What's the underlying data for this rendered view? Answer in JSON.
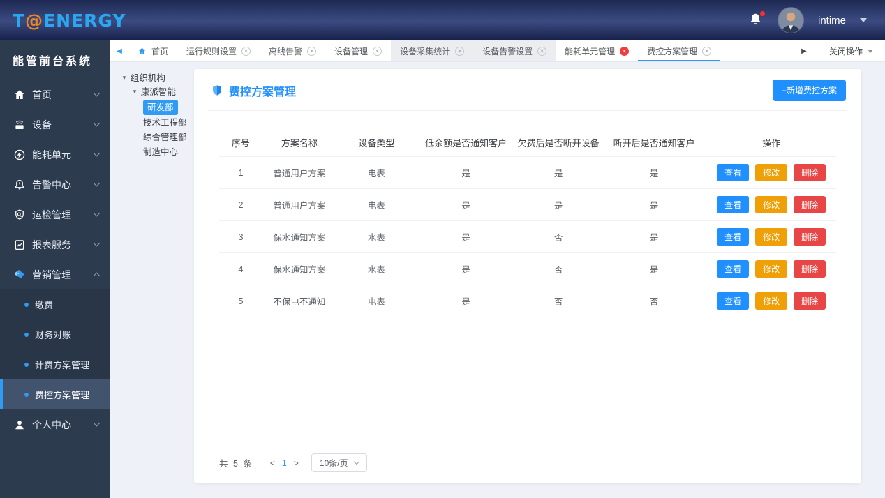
{
  "brand": {
    "logo_t": "T",
    "logo_at": "@",
    "logo_energy": "ENERGY"
  },
  "topbar": {
    "username": "intime"
  },
  "colors": {
    "accent": "#2f9bf4",
    "edit": "#efa007",
    "delete": "#e84646",
    "tab_close_alert": "#f23c3c"
  },
  "sidebar": {
    "app_title": "能管前台系统",
    "items": [
      {
        "key": "home",
        "label": "首页",
        "icon": "home-icon"
      },
      {
        "key": "device",
        "label": "设备",
        "icon": "device-icon"
      },
      {
        "key": "energy-unit",
        "label": "能耗单元",
        "icon": "energy-icon"
      },
      {
        "key": "alarm-center",
        "label": "告警中心",
        "icon": "alarm-icon"
      },
      {
        "key": "inspection",
        "label": "运检管理",
        "icon": "inspection-icon"
      },
      {
        "key": "reports",
        "label": "报表服务",
        "icon": "report-icon"
      },
      {
        "key": "marketing",
        "label": "营销管理",
        "icon": "tags-icon",
        "expanded": true,
        "children": [
          {
            "key": "payment",
            "label": "缴费"
          },
          {
            "key": "finance-reconcile",
            "label": "财务对账"
          },
          {
            "key": "billing-plan",
            "label": "计费方案管理"
          },
          {
            "key": "fee-control-plan",
            "label": "费控方案管理",
            "active": true
          }
        ]
      },
      {
        "key": "personal-center",
        "label": "个人中心",
        "icon": "user-icon"
      }
    ]
  },
  "tabbar": {
    "tabs": [
      {
        "key": "home",
        "label": "首页",
        "home": true
      },
      {
        "key": "run-rules",
        "label": "运行规则设置",
        "closable": true
      },
      {
        "key": "offline-alarm",
        "label": "离线告警",
        "closable": true
      },
      {
        "key": "device-mgmt",
        "label": "设备管理",
        "closable": true
      },
      {
        "key": "device-collect-stats",
        "label": "设备采集统计",
        "closable": true,
        "shaded": true
      },
      {
        "key": "device-alarm-settings",
        "label": "设备告警设置",
        "closable": true,
        "shaded": true
      },
      {
        "key": "energy-unit-mgmt",
        "label": "能耗单元管理",
        "closable": true,
        "close_style": "red"
      },
      {
        "key": "fee-control-plan",
        "label": "费控方案管理",
        "closable": true,
        "active": true
      }
    ],
    "close_menu_label": "关闭操作"
  },
  "tree": {
    "root": "组织机构",
    "company": "康派智能",
    "departments": [
      {
        "key": "rd",
        "label": "研发部",
        "selected": true
      },
      {
        "key": "tech-engineering",
        "label": "技术工程部"
      },
      {
        "key": "general-mgmt",
        "label": "综合管理部"
      },
      {
        "key": "manufacturing",
        "label": "制造中心"
      }
    ]
  },
  "content": {
    "title": "费控方案管理",
    "add_button": "+新增费控方案"
  },
  "table": {
    "headers": [
      "序号",
      "方案名称",
      "设备类型",
      "低余额是否通知客户",
      "欠费后是否断开设备",
      "断开后是否通知客户",
      "操作"
    ],
    "col_widths": [
      "7%",
      "12%",
      "13%",
      "16%",
      "14%",
      "17%",
      "21%"
    ],
    "rows": [
      {
        "no": "1",
        "name": "普通用户方案",
        "type": "电表",
        "notify_low": "是",
        "cut_on_arrears": "是",
        "notify_after_cut": "是"
      },
      {
        "no": "2",
        "name": "普通用户方案",
        "type": "电表",
        "notify_low": "是",
        "cut_on_arrears": "是",
        "notify_after_cut": "是"
      },
      {
        "no": "3",
        "name": "保水通知方案",
        "type": "水表",
        "notify_low": "是",
        "cut_on_arrears": "否",
        "notify_after_cut": "是"
      },
      {
        "no": "4",
        "name": "保水通知方案",
        "type": "水表",
        "notify_low": "是",
        "cut_on_arrears": "否",
        "notify_after_cut": "是"
      },
      {
        "no": "5",
        "name": "不保电不通知",
        "type": "电表",
        "notify_low": "是",
        "cut_on_arrears": "否",
        "notify_after_cut": "否"
      }
    ],
    "actions": {
      "view": "查看",
      "edit": "修改",
      "delete": "删除"
    }
  },
  "pagination": {
    "total_text": "共 5 条",
    "prev": "<",
    "current_page": "1",
    "next": ">",
    "page_size": "10条/页"
  }
}
